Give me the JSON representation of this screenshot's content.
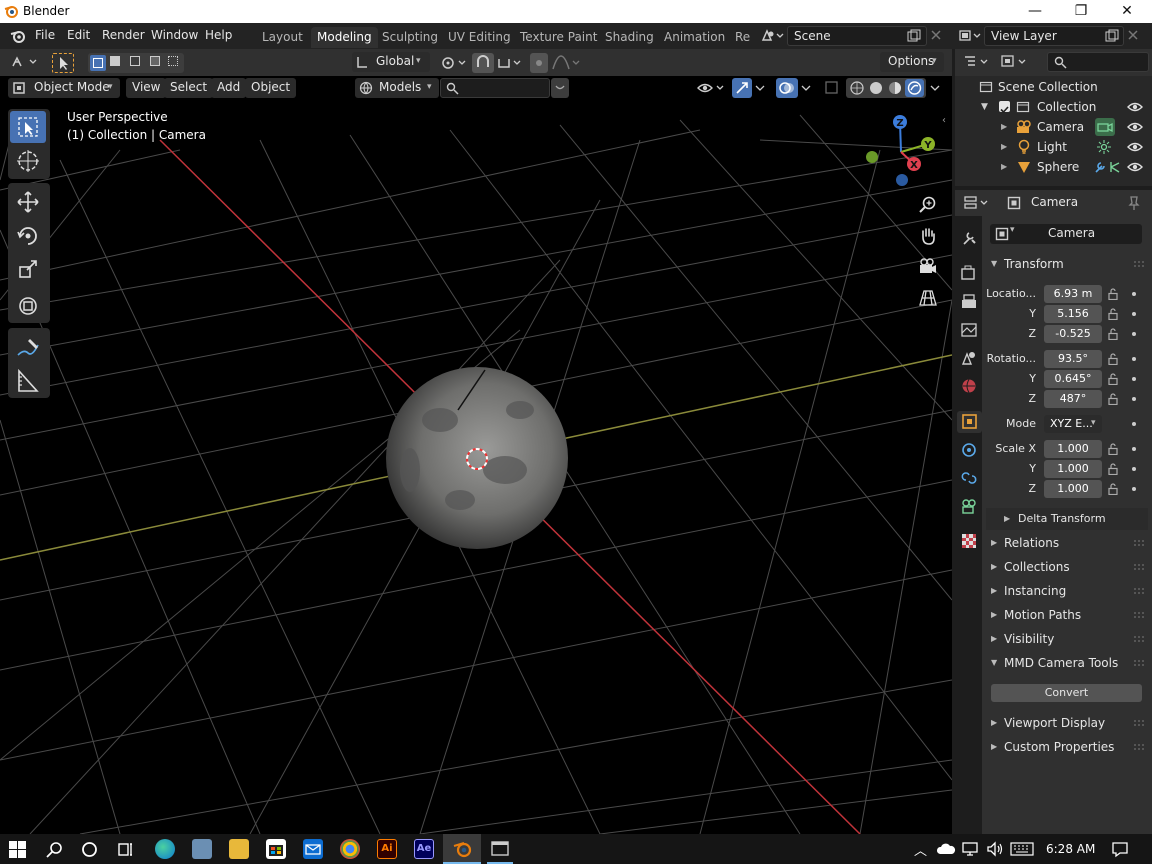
{
  "window": {
    "title": "Blender",
    "minimize": "—",
    "maximize": "❐",
    "close": "✕"
  },
  "menu": {
    "file": "File",
    "edit": "Edit",
    "render": "Render",
    "window": "Window",
    "help": "Help"
  },
  "workspaces": [
    {
      "label": "Layout"
    },
    {
      "label": "Modeling"
    },
    {
      "label": "Sculpting"
    },
    {
      "label": "UV Editing"
    },
    {
      "label": "Texture Paint"
    },
    {
      "label": "Shading"
    },
    {
      "label": "Animation"
    },
    {
      "label": "Re"
    }
  ],
  "active_workspace": "Modeling",
  "scene": {
    "name": "Scene",
    "view_layer": "View Layer"
  },
  "tool_header": {
    "orientation": "Global",
    "options": "Options"
  },
  "view_header": {
    "mode": "Object Mode",
    "view": "View",
    "select": "Select",
    "add": "Add",
    "object": "Object",
    "models": "Models"
  },
  "viewport": {
    "perspective": "User Perspective",
    "context": "(1) Collection | Camera",
    "gizmo": {
      "z": "Z",
      "y": "Y",
      "x": "X"
    }
  },
  "outliner": {
    "root": "Scene Collection",
    "collection": "Collection",
    "objects": [
      {
        "name": "Camera"
      },
      {
        "name": "Light"
      },
      {
        "name": "Sphere"
      }
    ]
  },
  "properties": {
    "header_object": "Camera",
    "object_name": "Camera",
    "transform_label": "Transform",
    "location_label": "Locatio...",
    "location": {
      "x": "6.93 m",
      "y": "5.156",
      "z": "-0.525"
    },
    "rotation_label": "Rotatio...",
    "rotation": {
      "x": "93.5°",
      "y": "0.645°",
      "z": "487°"
    },
    "mode_label": "Mode",
    "mode_value": "XYZ E...",
    "scale_label": "Scale X",
    "scale": {
      "x": "1.000",
      "y": "1.000",
      "z": "1.000"
    },
    "axis_y": "Y",
    "axis_z": "Z",
    "delta_transform": "Delta Transform",
    "sections": [
      {
        "label": "Relations"
      },
      {
        "label": "Collections"
      },
      {
        "label": "Instancing"
      },
      {
        "label": "Motion Paths"
      },
      {
        "label": "Visibility"
      }
    ],
    "mmd_camera_tools": "MMD Camera Tools",
    "convert": "Convert",
    "sections_bottom": [
      {
        "label": "Viewport Display"
      },
      {
        "label": "Custom Properties"
      }
    ]
  },
  "taskbar": {
    "time": "6:28 AM"
  }
}
